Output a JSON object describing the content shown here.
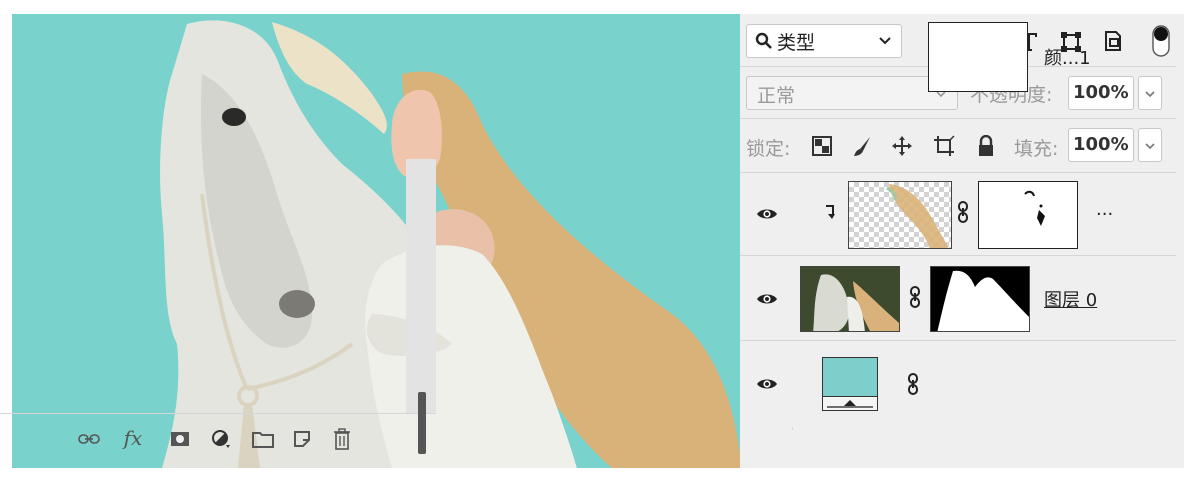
{
  "filter": {
    "kind_label": "类型",
    "filter_icons": [
      "image-filter-icon",
      "adjustment-filter-icon",
      "type-filter-icon",
      "shape-filter-icon",
      "smart-object-filter-icon",
      "filter-toggle-icon"
    ]
  },
  "blend": {
    "mode": "正常",
    "opacity_label": "不透明度:",
    "opacity_value": "100%"
  },
  "lock": {
    "label": "锁定:",
    "fill_label": "填充:",
    "fill_value": "100%"
  },
  "layers": [
    {
      "name": "...",
      "clipped": true
    },
    {
      "name": "图层 0",
      "clipped": false
    },
    {
      "name": "颜...1",
      "clipped": false
    }
  ],
  "colors": {
    "canvas_bg": "#79d2cc",
    "swatch": "#7ecfcc",
    "panel_bg": "#efefef"
  },
  "bottom_icons": [
    "link-layers-icon",
    "fx-icon",
    "mask-icon",
    "adjustment-icon",
    "group-folder-icon",
    "new-layer-icon",
    "trash-icon"
  ]
}
